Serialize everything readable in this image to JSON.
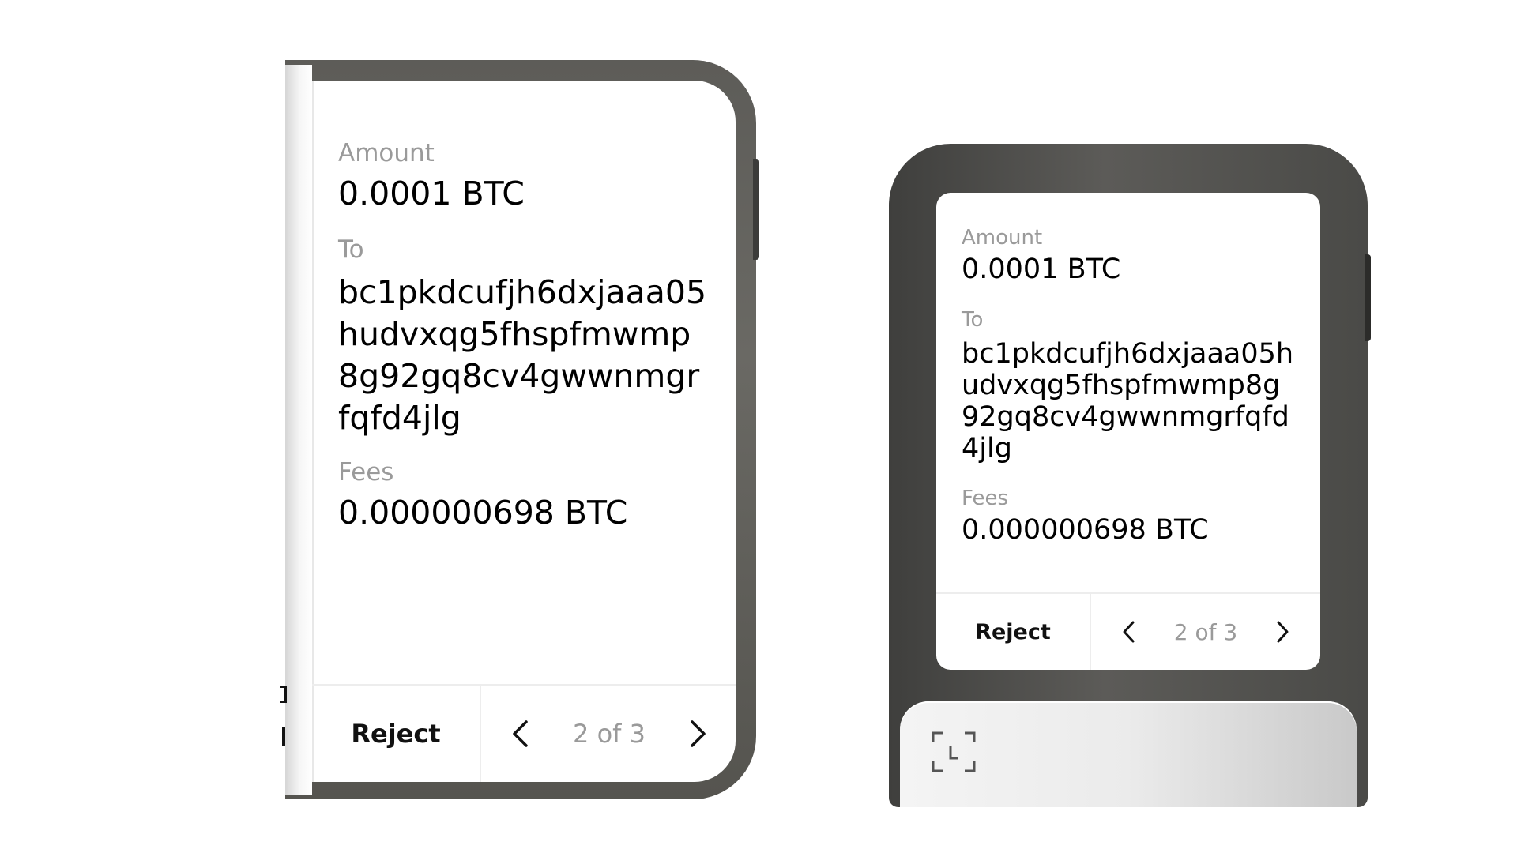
{
  "screen": {
    "amount_label": "Amount",
    "amount_value": "0.0001 BTC",
    "to_label": "To",
    "to_address": "bc1pkdcufjh6dxjaaa05hudvxqg5fhspfmwmp8g92gq8cv4gwwnmgrfqfd4jlg",
    "fees_label": "Fees",
    "fees_value": "0.000000698 BTC",
    "reject_label": "Reject",
    "page_indicator": "2 of 3"
  },
  "icons": {
    "prev": "chevron-left-icon",
    "next": "chevron-right-icon",
    "scan": "qr-scan-icon"
  },
  "colors": {
    "label_gray": "#9a9a9a",
    "frame_dark": "#5d5c58"
  }
}
